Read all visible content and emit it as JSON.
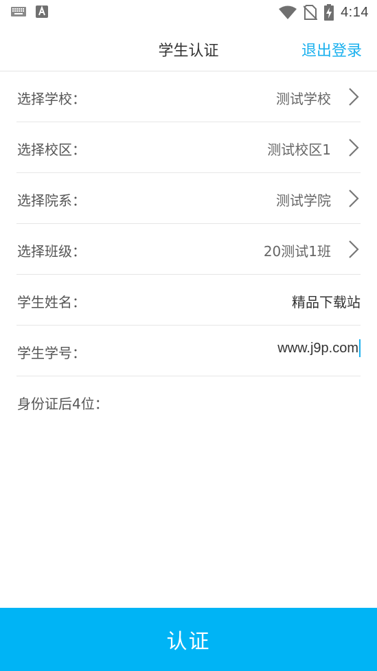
{
  "status_bar": {
    "left_icons": [
      "keyboard-icon",
      "app-a-icon"
    ],
    "right_icons": [
      "wifi-icon",
      "no-sim-icon",
      "battery-charging-icon"
    ],
    "time": "4:14"
  },
  "header": {
    "title": "学生认证",
    "logout_label": "退出登录"
  },
  "form": {
    "rows": [
      {
        "label": "选择学校：",
        "value": "测试学校"
      },
      {
        "label": "选择校区：",
        "value": "测试校区1"
      },
      {
        "label": "选择院系：",
        "value": "测试学院"
      },
      {
        "label": "选择班级：",
        "value": "20测试1班"
      },
      {
        "label": "学生姓名：",
        "value": "精品下载站"
      },
      {
        "label": "学生学号：",
        "value": "www.j9p.com"
      },
      {
        "label": "身份证后4位：",
        "value": ""
      }
    ]
  },
  "submit_label": "认证",
  "colors": {
    "accent": "#1ab0ee",
    "submit_bg": "#00b4f5"
  }
}
